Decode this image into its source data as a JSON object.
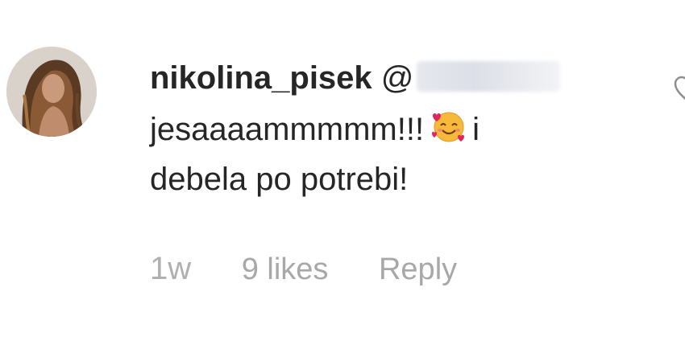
{
  "comment": {
    "username": "nikolina_pisek",
    "mention_prefix": "@",
    "text_before_emoji": "jesaaaammmmm!!!",
    "text_after_emoji": "i debela po potrebi!",
    "emoji": "smiling-face-with-hearts",
    "time": "1w",
    "likes": "9 likes",
    "reply_label": "Reply"
  },
  "colors": {
    "text": "#262626",
    "meta": "#a8a8a8",
    "background": "#ffffff"
  }
}
